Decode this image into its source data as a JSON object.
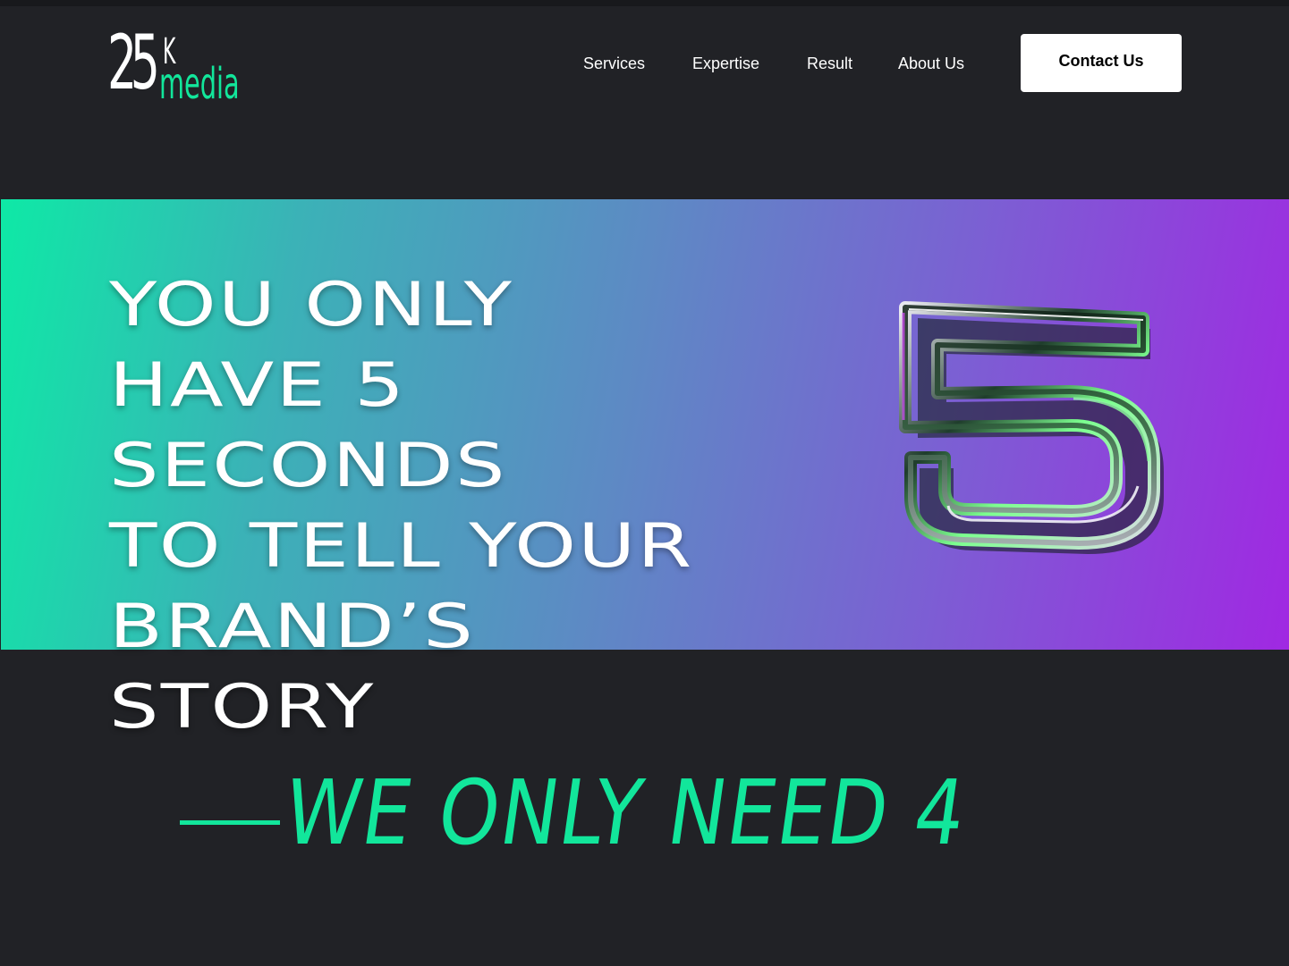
{
  "brand": {
    "logo_number": "25",
    "logo_superscript": "K",
    "logo_word": "media"
  },
  "nav": {
    "items": [
      {
        "label": "Services"
      },
      {
        "label": "Expertise"
      },
      {
        "label": "Result"
      },
      {
        "label": "About Us"
      }
    ],
    "contact_label": "Contact Us"
  },
  "hero": {
    "headline_lines": [
      "YOU ONLY",
      "HAVE 5",
      "SECONDS",
      "TO TELL YOUR",
      "BRAND’S",
      "STORY"
    ],
    "graphic_digit": "5",
    "tagline": "WE ONLY NEED 4"
  },
  "colors": {
    "background": "#212226",
    "accent_green": "#12e69b",
    "gradient_start": "#0ee9a6",
    "gradient_end": "#a028e2",
    "button_bg": "#ffffff"
  },
  "icons": {
    "digit_graphic": "chrome-5-icon"
  }
}
